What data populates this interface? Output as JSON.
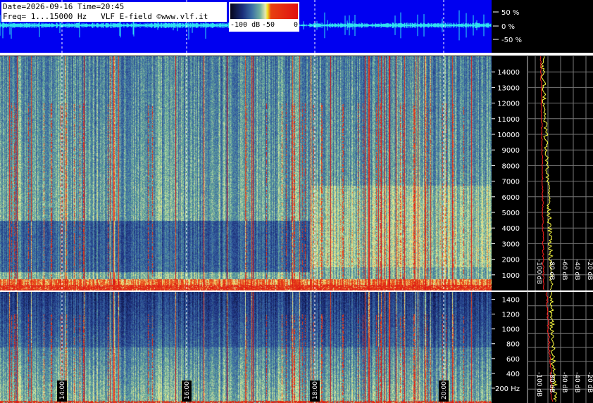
{
  "header": {
    "line1": "Date=2026-09-16 Time=20:45",
    "line2": "Freq= 1...15000 Hz   VLF E-field ©www.vlf.it"
  },
  "colorscale": {
    "labels": [
      "-100 dB",
      "-50",
      "0"
    ],
    "colors": [
      "#06061c",
      "#1a2e7a",
      "#3b6fa5",
      "#6fb0a0",
      "#e8e8b0",
      "#f0e020",
      "#e84010",
      "#e01010"
    ]
  },
  "waveform": {
    "pct_labels": [
      "50 %",
      "0 %",
      "-50 %"
    ],
    "color": "#30e0f0",
    "background": "#0000f0"
  },
  "chart_data": [
    {
      "type": "heatmap",
      "name": "spectrogram-upper",
      "y_ticks": [
        1000,
        2000,
        3000,
        4000,
        5000,
        6000,
        7000,
        8000,
        9000,
        10000,
        11000,
        12000,
        13000,
        14000
      ],
      "ylim": [
        0,
        15000
      ],
      "x_ticks": [
        "14:00",
        "16:00",
        "18:00",
        "20:00"
      ]
    },
    {
      "type": "heatmap",
      "name": "spectrogram-lower",
      "y_ticks": [
        "200 Hz",
        "400",
        "600",
        "800",
        "1000",
        "1200",
        "1400"
      ],
      "ylim": [
        0,
        1500
      ],
      "x_ticks": [
        "14:00",
        "16:00",
        "18:00",
        "20:00"
      ]
    },
    {
      "type": "line",
      "name": "spectrum-profile",
      "x_ticks": [
        "-100 dB",
        "-80 dB",
        "-60 dB",
        "-40 dB",
        "-20 dB"
      ],
      "series_colors": [
        "#ffff40",
        "#ff2020"
      ]
    }
  ]
}
